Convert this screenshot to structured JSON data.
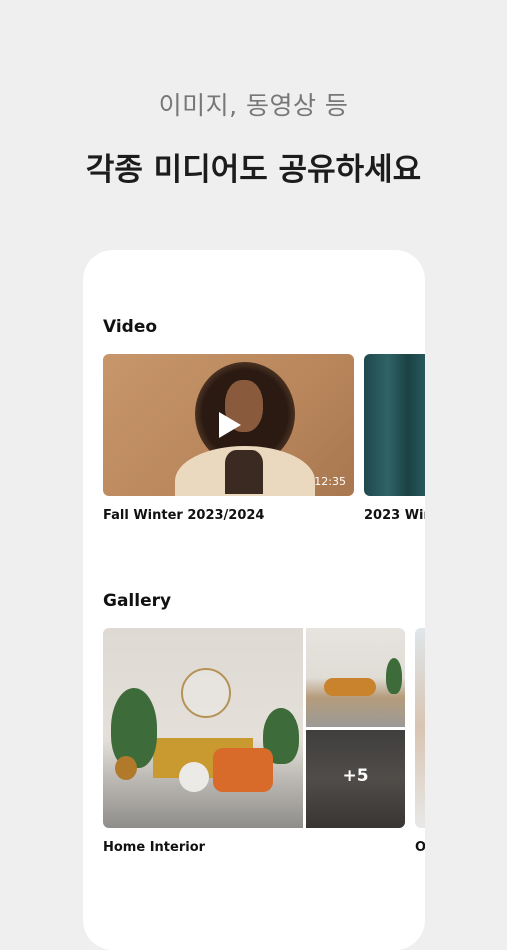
{
  "header": {
    "subtitle": "이미지, 동영상 등",
    "title": "각종 미디어도 공유하세요"
  },
  "video_section": {
    "title": "Video",
    "items": [
      {
        "caption": "Fall Winter 2023/2024",
        "duration": "12:35"
      },
      {
        "caption": "2023 Win"
      }
    ]
  },
  "gallery_section": {
    "title": "Gallery",
    "items": [
      {
        "caption": "Home Interior",
        "more_count": "+5"
      },
      {
        "caption": "O"
      }
    ]
  }
}
